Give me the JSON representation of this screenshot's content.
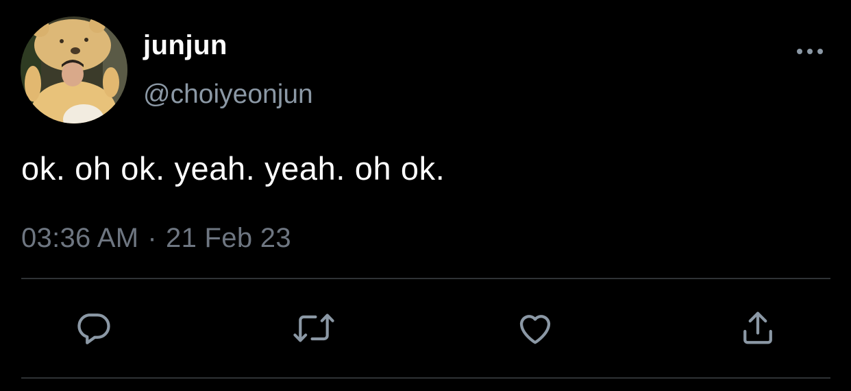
{
  "user": {
    "display_name": "junjun",
    "handle": "@choiyeonjun",
    "avatar_icon": "avatar-bear-costume"
  },
  "tweet": {
    "text": "ok. oh ok. yeah. yeah. oh ok.",
    "time": "03:36 AM",
    "separator": "·",
    "date": "21 Feb 23"
  },
  "actions": {
    "more_icon": "more-horizontal-icon",
    "reply_icon": "reply-icon",
    "retweet_icon": "retweet-icon",
    "like_icon": "heart-icon",
    "share_icon": "share-icon"
  },
  "colors": {
    "background": "#000000",
    "text_primary": "#ffffff",
    "text_secondary": "#8b98a5",
    "icon": "#8b98a5",
    "divider": "#2f3336"
  }
}
